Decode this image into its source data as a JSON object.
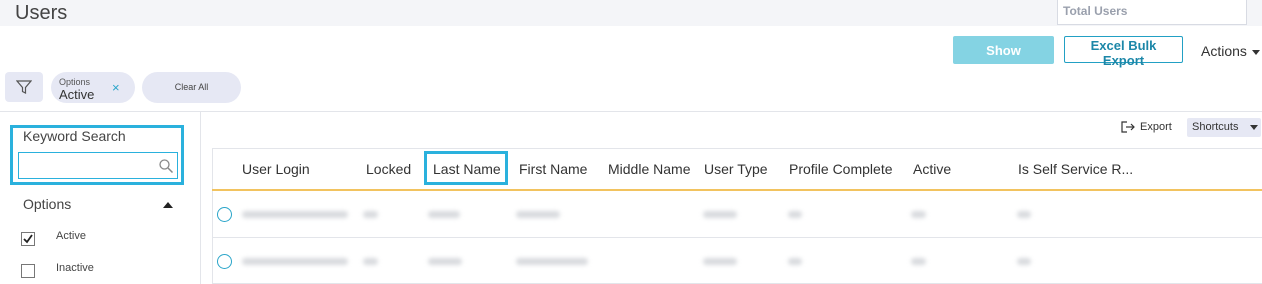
{
  "header": {
    "title": "Users",
    "total_users_label": "Total Users"
  },
  "toolbar": {
    "show_label": "Show",
    "excel_label": "Excel Bulk Export",
    "actions_label": "Actions"
  },
  "filters": {
    "chip_label": "Options",
    "chip_value": "Active",
    "chip_close": "×",
    "clear_all": "Clear All"
  },
  "sidebar": {
    "keyword_label": "Keyword Search",
    "keyword_value": "",
    "options_title": "Options",
    "options": [
      {
        "label": "Active",
        "checked": true
      },
      {
        "label": "Inactive",
        "checked": false
      }
    ]
  },
  "grid_toolbar": {
    "export_label": "Export",
    "shortcuts_label": "Shortcuts"
  },
  "table": {
    "columns": [
      "User Login",
      "Locked",
      "Last Name",
      "First Name",
      "Middle Name",
      "User Type",
      "Profile Complete",
      "Active",
      "Is Self Service R..."
    ]
  },
  "colors": {
    "accent": "#2ab1dd",
    "show_button": "#84d3e3",
    "header_underline": "#f2c35f",
    "chip_bg": "#e6e8f4"
  },
  "icons": {
    "filter": "funnel-icon",
    "search": "magnifier-icon",
    "export": "export-arrow-icon"
  }
}
